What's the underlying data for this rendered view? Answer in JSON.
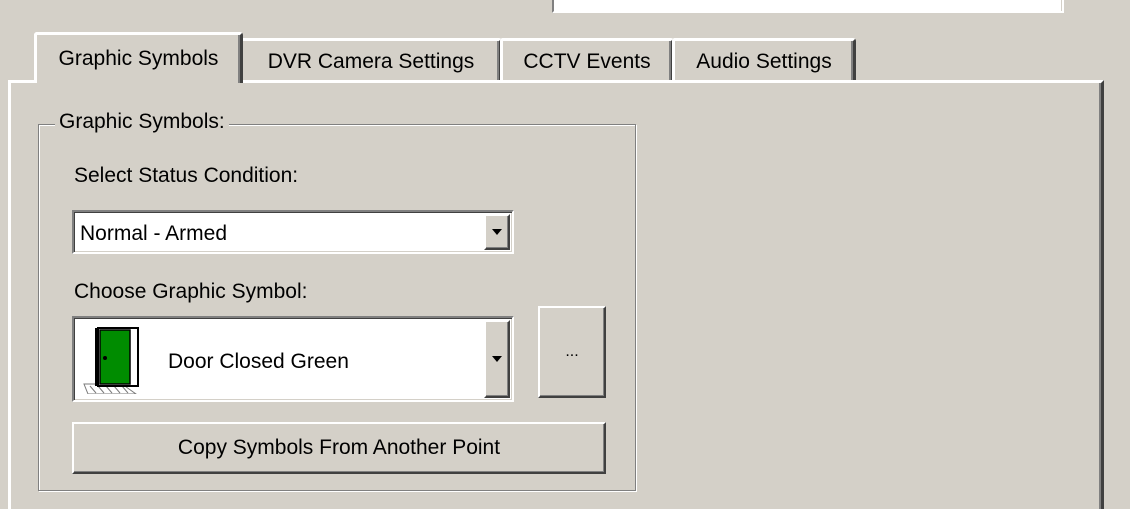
{
  "tabs": [
    {
      "label": "Graphic Symbols",
      "active": true
    },
    {
      "label": "DVR Camera Settings",
      "active": false
    },
    {
      "label": "CCTV Events",
      "active": false
    },
    {
      "label": "Audio Settings",
      "active": false
    }
  ],
  "group": {
    "title": "Graphic Symbols:",
    "status_label": "Select Status Condition:",
    "status_value": "Normal - Armed",
    "symbol_label": "Choose Graphic Symbol:",
    "symbol_value": "Door Closed Green",
    "symbol_icon": "door-closed-green-icon",
    "browse_label": "...",
    "copy_label": "Copy Symbols From Another Point"
  },
  "colors": {
    "face": "#d4d0c8",
    "door_green": "#008c00"
  }
}
